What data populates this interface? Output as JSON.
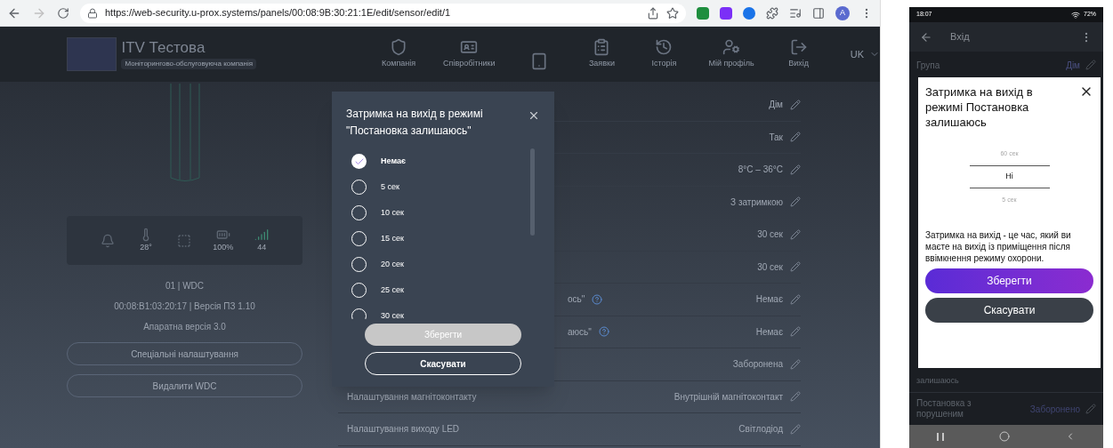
{
  "browser": {
    "url": "https://web-security.u-prox.systems/panels/00:08:9B:30:21:1E/edit/sensor/edit/1",
    "avatar": "A"
  },
  "web_page": {
    "company": {
      "name": "ITV Тестова",
      "tag": "Моніторингово-обслуговуюча компанія"
    },
    "nav": [
      {
        "kind": "shield",
        "label": "Компанія"
      },
      {
        "kind": "card",
        "label": "Співробітники"
      },
      {
        "kind": "device"
      },
      {
        "kind": "clipboard",
        "label": "Заявки"
      },
      {
        "kind": "history",
        "label": "Історія"
      },
      {
        "kind": "profile",
        "label": "Мій профіль"
      },
      {
        "kind": "logout",
        "label": "Вихід"
      }
    ],
    "language": "UK",
    "device_stats": [
      {
        "kind": "alarm"
      },
      {
        "kind": "temperature",
        "value": "28°"
      },
      {
        "kind": "tamper"
      },
      {
        "kind": "battery",
        "value": "100%"
      },
      {
        "kind": "signal",
        "value": "44"
      }
    ],
    "device_name": "01 | WDC",
    "device_info": "00:08:B1:03:20:17 | Версія ПЗ 1.10",
    "hardware": "Апаратна версія 3.0",
    "buttons": [
      "Спеціальні налаштування",
      "Видалити WDC"
    ],
    "settings": [
      {
        "value": "Дім"
      },
      {
        "value": "Так"
      },
      {
        "value": "8°C – 36°C"
      },
      {
        "value": "З затримкою"
      },
      {
        "value": "30 сек"
      },
      {
        "value": "30 сек"
      },
      {
        "label": "ось\"",
        "partial": true,
        "help": true,
        "value": "Немає"
      },
      {
        "label": "аюсь\"",
        "partial": true,
        "help": true,
        "value": "Немає"
      },
      {
        "value": "Заборонена"
      },
      {
        "label": "Налаштування магнітоконтакту",
        "value": "Внутрішній магнітоконтакт"
      },
      {
        "label": "Налаштування виходу LED",
        "value": "Світлодіод"
      }
    ]
  },
  "dialog": {
    "title_lines": [
      "Затримка на вихід в режимі",
      "\"Постановка залишаюсь\""
    ],
    "options": [
      {
        "label": "Немає",
        "selected": true
      },
      {
        "label": "5 сек",
        "selected": false
      },
      {
        "label": "10 сек",
        "selected": false
      },
      {
        "label": "15 сек",
        "selected": false
      },
      {
        "label": "20 сек",
        "selected": false
      },
      {
        "label": "25 сек",
        "selected": false
      },
      {
        "label": "30 сек",
        "selected": false
      }
    ],
    "save": {
      "label": "Зберегти",
      "disabled": true
    },
    "cancel": "Скасувати"
  },
  "phone": {
    "time": "18:07",
    "battery": "72%",
    "title": "Вхід",
    "group_label": "Група",
    "group_value": "Дім",
    "dialog": {
      "title": "Затримка на вихід в режимі Постановка залишаюсь",
      "picker": [
        {
          "label": "60 сек",
          "selected": false
        },
        {
          "label": "Ні",
          "selected": true
        },
        {
          "label": "5 сек",
          "selected": false
        }
      ],
      "description": "Затримка на вихід - це час, який ви маєте на вихід із приміщення після ввімкнення режиму охорони.",
      "save": "Зберегти",
      "cancel": "Скасувати"
    },
    "rows": [
      {
        "label": "залишаюсь"
      },
      {
        "label": "Постановка з порушеним",
        "value": "Заборонено"
      }
    ]
  }
}
